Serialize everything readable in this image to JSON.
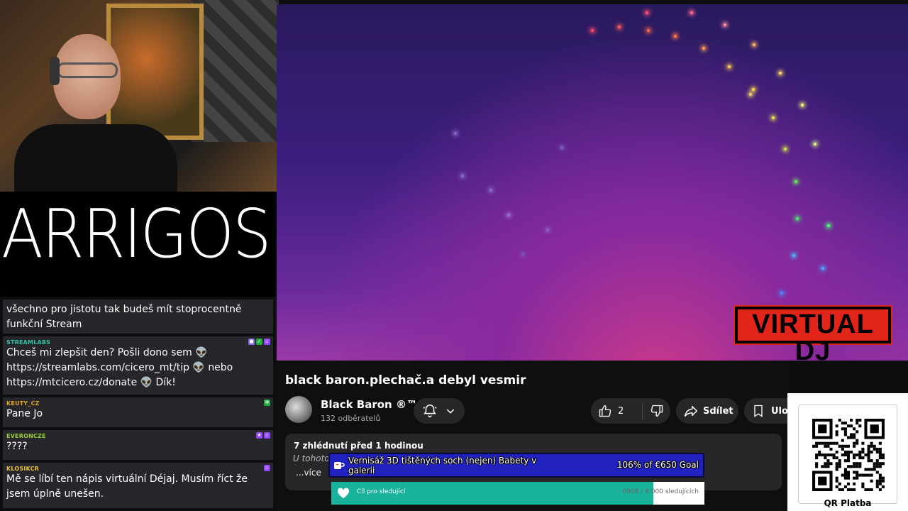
{
  "logo": {
    "text": "ARRIGOS"
  },
  "chat": {
    "messages": [
      {
        "user": "",
        "text": "všechno pro jistotu tak budeš mít stoprocentně funkční Stream"
      },
      {
        "user": "STREAMLABS",
        "user_color": "#32c3a6",
        "text": "Chceš mi zlepšit den? Pošli dono sem 👽 https://streamlabs.com/cicero_mt/tip 👽 nebo https://mtcicero.cz/donate 👽 Dík!"
      },
      {
        "user": "KEUTY_CZ",
        "user_color": "#e6a21f",
        "text": "Pane Jo"
      },
      {
        "user": "EVERONCZE",
        "user_color": "#9ad036",
        "text": "????"
      },
      {
        "user": "KLOSIKCR",
        "user_color": "#e8c03a",
        "text": "Mě se líbí ten nápis virtuální Déjaj. Musím říct že jsem úplně unešen."
      }
    ]
  },
  "video": {
    "overlay_logo": "VIRTUAL DJ"
  },
  "youtube": {
    "title": "black baron.plechač.a debyl vesmir",
    "channel": "Black Baron ®™",
    "subscribers": "132 odběratelů",
    "like_count": "2",
    "share_label": "Sdílet",
    "save_label": "Ulož",
    "views_time": "7 zhlédnutí  před 1 hodinou",
    "description_preview": "U tohoto",
    "more_label": "...více"
  },
  "goal": {
    "title": "Vernisáž 3D tištěných soch (nejen) Babety v galerii",
    "amount": "106% of €650 Goal",
    "progress": 1.0
  },
  "follow_goal": {
    "label": "Cíl pro sledující",
    "count": "6908 / 8 000 sledujících",
    "progress": 0.8635
  },
  "qr": {
    "label": "QR Platba"
  },
  "colors": {
    "accent_goal": "#1a1aa8",
    "follow_bar": "#19b39b",
    "vdj_red": "#e1251b"
  }
}
